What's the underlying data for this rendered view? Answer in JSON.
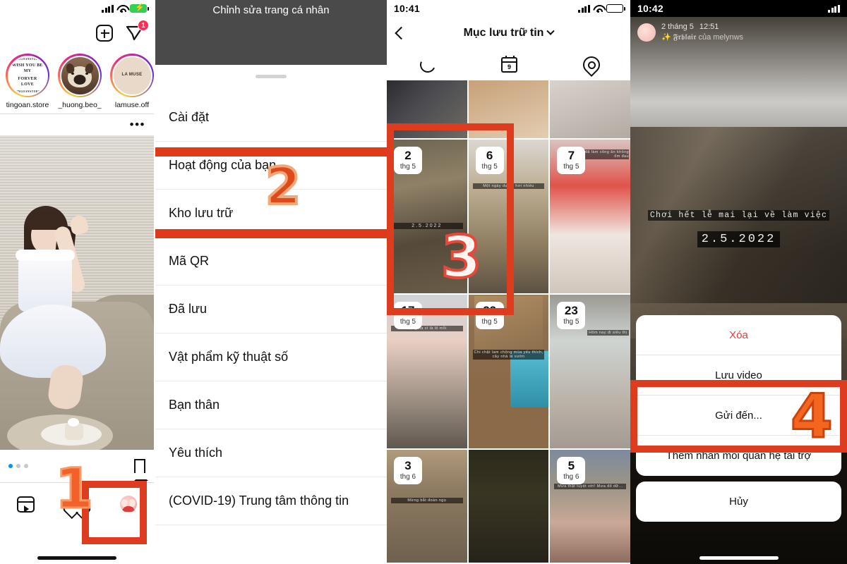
{
  "panel1": {
    "statusbar": {
      "signal": "signal-bars",
      "wifi": "wifi",
      "battery": "battery-charging"
    },
    "topbar": {
      "add_icon": "plus-square-icon",
      "dm_icon": "direct-message-icon",
      "dm_badge": "1"
    },
    "stories": [
      {
        "name": "tingoan.store",
        "art_line1": "WISH YOU BE MY",
        "art_line2": "FORVER LOVE",
        "art_top": "TINGOANSTORE",
        "art_bottom": "TINGOANSTORE"
      },
      {
        "name": "_huong.beo_",
        "art_line1": "",
        "art_line2": "",
        "art_top": "",
        "art_bottom": ""
      },
      {
        "name": "lamuse.off",
        "art_line1": "LA MUSE",
        "art_line2": "",
        "art_top": "",
        "art_bottom": ""
      }
    ],
    "post": {
      "more_icon": "more-options-icon",
      "save_icon": "bookmark-icon",
      "pager_dots": 3,
      "pager_active": 0
    },
    "tabs": [
      {
        "icon": "reels-icon",
        "label": ""
      },
      {
        "icon": "heart-icon",
        "label": ""
      },
      {
        "icon": "profile-avatar-icon",
        "label": ""
      }
    ]
  },
  "panel2": {
    "header_title": "Chỉnh sửa trang cá nhân",
    "menu": [
      "Cài đặt",
      "Hoạt động của bạn",
      "Kho lưu trữ",
      "Mã QR",
      "Đã lưu",
      "Vật phẩm kỹ thuật số",
      "Bạn thân",
      "Yêu thích",
      "(COVID-19) Trung tâm thông tin"
    ]
  },
  "panel3": {
    "statusbar": {
      "time": "10:41"
    },
    "nav": {
      "back_icon": "back-chevron-icon",
      "title": "Mục lưu trữ tin",
      "caret_icon": "chevron-down-icon"
    },
    "tabs": [
      {
        "icon": "stories-ring-icon",
        "name": "stories-archive-tab"
      },
      {
        "icon": "calendar-icon",
        "name": "calendar-tab",
        "day": "9"
      },
      {
        "icon": "map-pin-icon",
        "name": "map-tab"
      }
    ],
    "grid": [
      {
        "day": "",
        "month": "",
        "caption": ""
      },
      {
        "day": "",
        "month": "",
        "caption": ""
      },
      {
        "day": "",
        "month": "",
        "caption": ""
      },
      {
        "day": "2",
        "month": "thg 5",
        "caption": "2.5.2022"
      },
      {
        "day": "6",
        "month": "thg 5",
        "caption": "Một ngày dự ăn hơi nhiều"
      },
      {
        "day": "7",
        "month": "thg 5",
        "caption": "đã làm công ăn không ốm đau"
      },
      {
        "day": "17",
        "month": "thg 5",
        "caption": "Tặng na vì là lô mỗi"
      },
      {
        "day": "22",
        "month": "thg 5",
        "caption": "Chi chặt lam chộng mùa yếu thích, cây nhà lá vườn"
      },
      {
        "day": "23",
        "month": "thg 5",
        "caption": "Hôm nay đi siêu thị"
      },
      {
        "day": "3",
        "month": "thg 6",
        "caption": "Mừng bắt đoàn ngọ"
      },
      {
        "day": "",
        "month": "",
        "caption": ""
      },
      {
        "day": "5",
        "month": "thg 6",
        "caption": "Mưa thật tuyệt vời! Mưa đổ dữ..."
      }
    ]
  },
  "panel4": {
    "statusbar": {
      "time": "10:42"
    },
    "story": {
      "date": "2 tháng 5",
      "time": "12:51",
      "subtitle": "✨ 𝕱𝖗𝖇𝖑𝖆𝖎𝖗 của melynws",
      "overlay_text": "Chơi hết lễ mai lại về làm việc",
      "overlay_date": "2.5.2022"
    },
    "actionsheet": {
      "items": [
        "Xóa",
        "Lưu video",
        "Gửi đến...",
        "Thêm nhãn mối quan hệ tài trợ"
      ],
      "cancel": "Hủy"
    }
  },
  "annotations": {
    "numbers": [
      "1",
      "2",
      "3",
      "4"
    ],
    "accent_red": "#dd3c1e",
    "accent_orange": "#f4602a"
  }
}
